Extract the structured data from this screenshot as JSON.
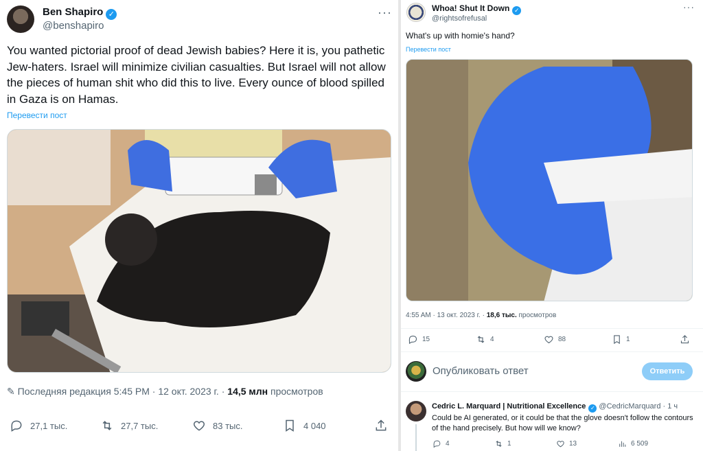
{
  "left_tweet": {
    "author_name": "Ben Shapiro",
    "author_handle": "@benshapiro",
    "text": "You wanted pictorial proof of dead Jewish babies? Here it is, you pathetic Jew-haters. Israel will minimize civilian casualties. But Israel will not allow the pieces of human shit who did this to live. Every ounce of blood spilled in Gaza is on Hamas.",
    "translate_label": "Перевести пост",
    "edited_label": "Последняя редакция",
    "time": "5:45 PM",
    "date": "12 окт. 2023 г.",
    "views_count": "14,5 млн",
    "views_label": "просмотров",
    "actions": {
      "replies": "27,1 тыс.",
      "reposts": "27,7 тыс.",
      "likes": "83 тыс.",
      "bookmarks": "4 040"
    }
  },
  "right_tweet": {
    "author_name": "Whoa! Shut It Down",
    "author_handle": "@rightsofrefusal",
    "text": "What's up with homie's hand?",
    "translate_label": "Перевести пост",
    "time": "4:55 AM",
    "date": "13 окт. 2023 г.",
    "views_count": "18,6 тыс.",
    "views_label": "просмотров",
    "actions": {
      "replies": "15",
      "reposts": "4",
      "likes": "88",
      "bookmarks": "1"
    }
  },
  "reply_composer": {
    "placeholder": "Опубликовать ответ",
    "button_label": "Ответить"
  },
  "reply": {
    "author_name": "Cedric L. Marquard | Nutritional Excellence",
    "author_handle": "@CedricMarquard",
    "age": "· 1 ч",
    "text": "Could be AI generated, or it could be that the glove doesn't follow the contours of the hand precisely. But how will we know?",
    "actions": {
      "replies": "4",
      "reposts": "1",
      "likes": "13",
      "views": "6 509"
    }
  },
  "colors": {
    "accent": "#1d9bf0",
    "glove": "#3f6ee0"
  }
}
